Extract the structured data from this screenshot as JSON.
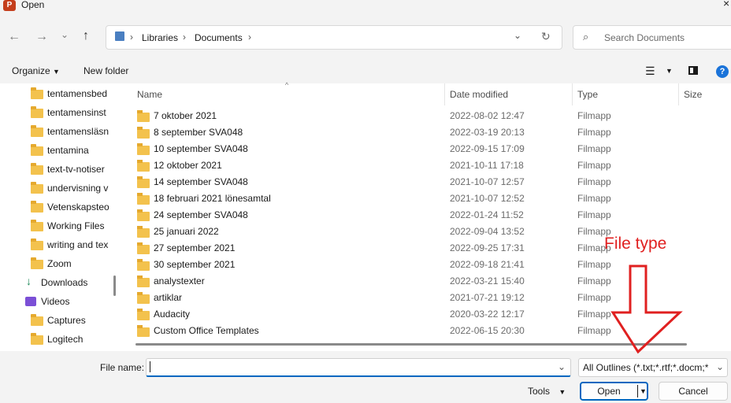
{
  "window": {
    "title": "Open",
    "app_icon_letter": "P"
  },
  "nav": {
    "path": [
      "Libraries",
      "Documents"
    ],
    "search_placeholder": "Search Documents"
  },
  "toolbar": {
    "organize": "Organize",
    "new_folder": "New folder"
  },
  "sidebar": {
    "items": [
      {
        "label": "tentamensbed",
        "icon": "folder-icon"
      },
      {
        "label": "tentamensinst",
        "icon": "folder-icon"
      },
      {
        "label": "tentamensläsn",
        "icon": "folder-icon"
      },
      {
        "label": "tentamina",
        "icon": "folder-icon"
      },
      {
        "label": "text-tv-notiser",
        "icon": "folder-icon"
      },
      {
        "label": "undervisning v",
        "icon": "folder-icon"
      },
      {
        "label": "Vetenskapsteo",
        "icon": "folder-icon"
      },
      {
        "label": "Working Files",
        "icon": "folder-icon"
      },
      {
        "label": "writing and tex",
        "icon": "folder-icon"
      },
      {
        "label": "Zoom",
        "icon": "folder-icon"
      },
      {
        "label": "Downloads",
        "icon": "download-icon"
      },
      {
        "label": "Videos",
        "icon": "video-icon"
      },
      {
        "label": "Captures",
        "icon": "folder-icon"
      },
      {
        "label": "Logitech",
        "icon": "folder-icon"
      }
    ]
  },
  "columns": {
    "name": "Name",
    "date": "Date modified",
    "type": "Type",
    "size": "Size"
  },
  "files": [
    {
      "name": "7 oktober 2021",
      "date": "2022-08-02 12:47",
      "type": "Filmapp"
    },
    {
      "name": "8 september SVA048",
      "date": "2022-03-19 20:13",
      "type": "Filmapp"
    },
    {
      "name": "10 september SVA048",
      "date": "2022-09-15 17:09",
      "type": "Filmapp"
    },
    {
      "name": "12 oktober 2021",
      "date": "2021-10-11 17:18",
      "type": "Filmapp"
    },
    {
      "name": "14 september SVA048",
      "date": "2021-10-07 12:57",
      "type": "Filmapp"
    },
    {
      "name": "18 februari 2021 lönesamtal",
      "date": "2021-10-07 12:52",
      "type": "Filmapp"
    },
    {
      "name": "24 september SVA048",
      "date": "2022-01-24 11:52",
      "type": "Filmapp"
    },
    {
      "name": "25 januari 2022",
      "date": "2022-09-04 13:52",
      "type": "Filmapp"
    },
    {
      "name": "27 september 2021",
      "date": "2022-09-25 17:31",
      "type": "Filmapp"
    },
    {
      "name": "30 september 2021",
      "date": "2022-09-18 21:41",
      "type": "Filmapp"
    },
    {
      "name": "analystexter",
      "date": "2022-03-21 15:40",
      "type": "Filmapp"
    },
    {
      "name": "artiklar",
      "date": "2021-07-21 19:12",
      "type": "Filmapp"
    },
    {
      "name": "Audacity",
      "date": "2020-03-22 12:17",
      "type": "Filmapp"
    },
    {
      "name": "Custom Office Templates",
      "date": "2022-06-15 20:30",
      "type": "Filmapp"
    }
  ],
  "bottom": {
    "file_name_label": "File name:",
    "file_name_value": "",
    "file_type": "All Outlines (*.txt;*.rtf;*.docm;*",
    "tools": "Tools",
    "open": "Open",
    "cancel": "Cancel"
  },
  "annotation": {
    "text": "File type",
    "color": "#e02020"
  }
}
